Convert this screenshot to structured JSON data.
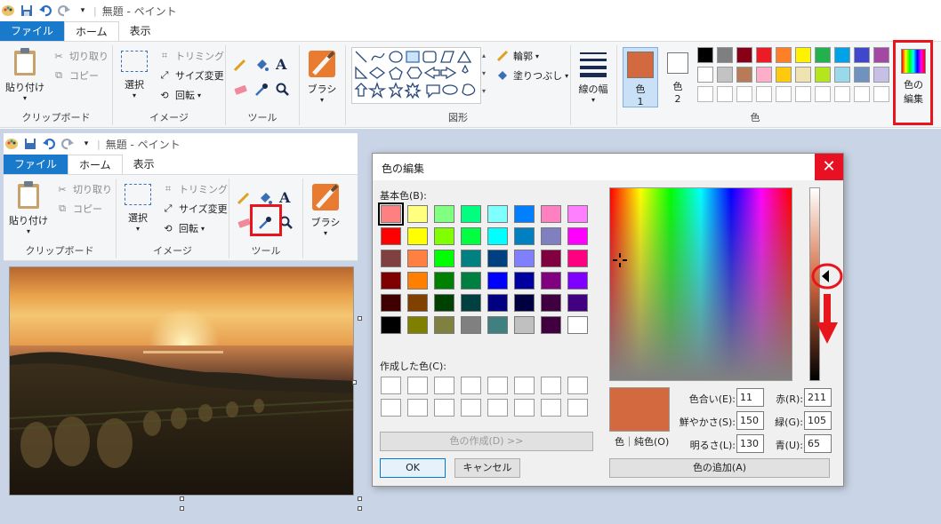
{
  "top": {
    "title": "無題 - ペイント",
    "tabs": [
      "ファイル",
      "ホーム",
      "表示"
    ],
    "clipboard": {
      "paste": "貼り付け",
      "cut": "切り取り",
      "copy": "コピー",
      "label": "クリップボード"
    },
    "image": {
      "select": "選択",
      "crop": "トリミング",
      "resize": "サイズ変更",
      "rotate": "回転",
      "label": "イメージ"
    },
    "tools": {
      "text_glyph": "A",
      "label": "ツール"
    },
    "brush": {
      "label": "ブラシ"
    },
    "shapes": {
      "outline": "輪郭",
      "fill": "塗りつぶし",
      "label": "図形"
    },
    "width": {
      "label": "線の幅"
    },
    "colors": {
      "color1": "色",
      "color1_num": "1",
      "color2": "色",
      "color2_num": "2",
      "label": "色",
      "edit_label_1": "色の",
      "edit_label_2": "編集"
    },
    "palette_row1": [
      "#000000",
      "#7f7f7f",
      "#880015",
      "#ed1c24",
      "#ff7f27",
      "#fff200",
      "#22b14c",
      "#00a2e8",
      "#3f48cc",
      "#a349a4"
    ],
    "palette_row2": [
      "#ffffff",
      "#c3c3c3",
      "#b97a57",
      "#ffaec9",
      "#ffc90e",
      "#efe4b0",
      "#b5e61d",
      "#99d9ea",
      "#7092be",
      "#c8bfe7"
    ],
    "color1_swatch": "#d3693f"
  },
  "inner": {
    "title": "無題 - ペイント",
    "tabs": [
      "ファイル",
      "ホーム",
      "表示"
    ],
    "clipboard": {
      "paste": "貼り付け",
      "cut": "切り取り",
      "copy": "コピー",
      "label": "クリップボード"
    },
    "image": {
      "select": "選択",
      "crop": "トリミング",
      "resize": "サイズ変更",
      "rotate": "回転",
      "label": "イメージ"
    },
    "tools": {
      "text_glyph": "A",
      "label": "ツール"
    },
    "brush": {
      "label": "ブラシ"
    }
  },
  "dialog": {
    "title": "色の編集",
    "close_glyph": "✕",
    "basic_label": "基本色(B):",
    "custom_label": "作成した色(C):",
    "define_button": "色の作成(D) >>",
    "ok": "OK",
    "cancel": "キャンセル",
    "add_button": "色の追加(A)",
    "preview_caption": "色｜純色(O)",
    "hue_label": "色合い(E):",
    "hue": "11",
    "sat_label": "鮮やかさ(S):",
    "sat": "150",
    "lum_label": "明るさ(L):",
    "lum": "130",
    "red_label": "赤(R):",
    "red": "211",
    "green_label": "緑(G):",
    "green": "105",
    "blue_label": "青(U):",
    "blue": "65",
    "preview_color": "#d3693f",
    "basic_colors": [
      [
        "#ff8080",
        "#ffff80",
        "#80ff80",
        "#00ff80",
        "#80ffff",
        "#0080ff",
        "#ff80c0",
        "#ff80ff"
      ],
      [
        "#ff0000",
        "#ffff00",
        "#80ff00",
        "#00ff40",
        "#00ffff",
        "#0080c0",
        "#8080c0",
        "#ff00ff"
      ],
      [
        "#804040",
        "#ff8040",
        "#00ff00",
        "#008080",
        "#004080",
        "#8080ff",
        "#800040",
        "#ff0080"
      ],
      [
        "#800000",
        "#ff8000",
        "#008000",
        "#008040",
        "#0000ff",
        "#0000a0",
        "#800080",
        "#8000ff"
      ],
      [
        "#400000",
        "#804000",
        "#004000",
        "#004040",
        "#000080",
        "#000040",
        "#400040",
        "#400080"
      ],
      [
        "#000000",
        "#808000",
        "#808040",
        "#808080",
        "#408080",
        "#c0c0c0",
        "#400040",
        "#ffffff"
      ]
    ]
  }
}
